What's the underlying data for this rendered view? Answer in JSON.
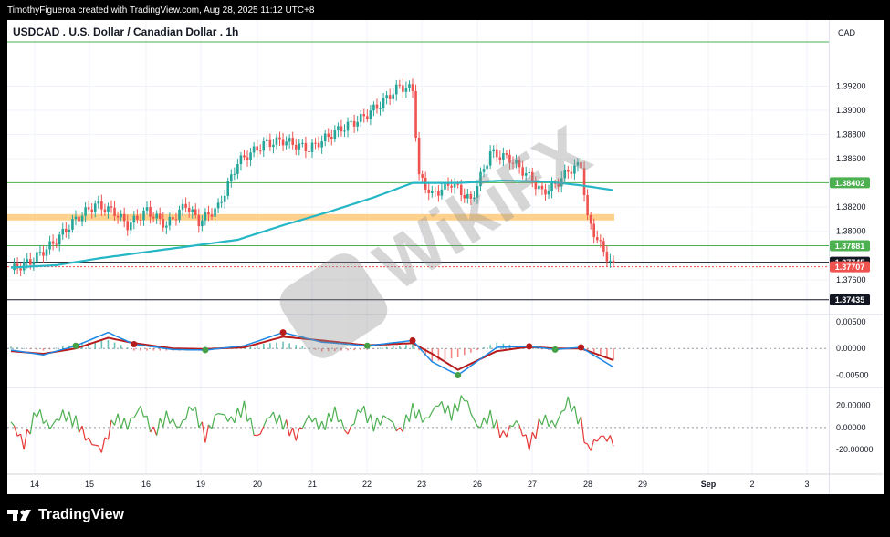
{
  "header": {
    "attribution": "TimothyFigueroa created with TradingView.com, Aug 28, 2025 11:12 UTC+8"
  },
  "chart_header": {
    "symbol_title": "USDCAD . U.S. Dollar / Canadian Dollar . 1h",
    "currency": "CAD"
  },
  "footer": {
    "brand": "TradingView"
  },
  "watermark": "WikiFX",
  "colors": {
    "up": "#26a69a",
    "down": "#ef5350",
    "ma": "#26b7c7",
    "zone": "#ffcc80",
    "green_line": "#4caf50",
    "macd": "#2e7d32",
    "signal": "#b71c1c",
    "rsi_up": "#4caf50",
    "rsi_dn": "#e53935"
  },
  "chart_data": [
    {
      "type": "candlestick",
      "title": "USDCAD . U.S. Dollar / Canadian Dollar . 1h",
      "x_ticks": [
        "14",
        "15",
        "16",
        "19",
        "20",
        "21",
        "22",
        "23",
        "26",
        "27",
        "28",
        "29",
        "Sep",
        "2",
        "3"
      ],
      "y_ticks": [
        "1.39200",
        "1.39000",
        "1.38800",
        "1.38600",
        "1.38200",
        "1.38000",
        "1.37600"
      ],
      "y_range": [
        1.3735,
        1.3955
      ],
      "price_path": [
        [
          0,
          1.3768
        ],
        [
          6,
          1.3775
        ],
        [
          13,
          1.379
        ],
        [
          20,
          1.381
        ],
        [
          26,
          1.3822
        ],
        [
          32,
          1.3816
        ],
        [
          36,
          1.3805
        ],
        [
          42,
          1.3817
        ],
        [
          48,
          1.3805
        ],
        [
          54,
          1.3822
        ],
        [
          58,
          1.3808
        ],
        [
          64,
          1.382
        ],
        [
          70,
          1.3857
        ],
        [
          78,
          1.3872
        ],
        [
          84,
          1.3875
        ],
        [
          92,
          1.3868
        ],
        [
          100,
          1.3882
        ],
        [
          108,
          1.3893
        ],
        [
          114,
          1.3905
        ],
        [
          120,
          1.392
        ],
        [
          124,
          1.3917
        ],
        [
          126,
          1.3845
        ],
        [
          130,
          1.383
        ],
        [
          136,
          1.384
        ],
        [
          142,
          1.3825
        ],
        [
          148,
          1.3865
        ],
        [
          154,
          1.386
        ],
        [
          160,
          1.3845
        ],
        [
          164,
          1.3832
        ],
        [
          168,
          1.3838
        ],
        [
          172,
          1.385
        ],
        [
          176,
          1.3855
        ],
        [
          178,
          1.381
        ],
        [
          182,
          1.3788
        ],
        [
          186,
          1.377
        ]
      ],
      "ma_path": [
        [
          0,
          1.377
        ],
        [
          14,
          1.3772
        ],
        [
          28,
          1.3778
        ],
        [
          42,
          1.3783
        ],
        [
          56,
          1.3788
        ],
        [
          70,
          1.3793
        ],
        [
          84,
          1.3805
        ],
        [
          98,
          1.3816
        ],
        [
          112,
          1.3828
        ],
        [
          124,
          1.384
        ],
        [
          138,
          1.384
        ],
        [
          152,
          1.3842
        ],
        [
          166,
          1.3841
        ],
        [
          176,
          1.3838
        ],
        [
          186,
          1.3834
        ]
      ],
      "horizontal_levels": [
        {
          "label": "1.38402",
          "value": 1.38402,
          "color": "#4caf50"
        },
        {
          "label": "1.37881",
          "value": 1.37881,
          "color": "#4caf50"
        },
        {
          "label": "1.37745",
          "value": 1.37745,
          "color": "#131722"
        },
        {
          "label": "1.37707",
          "value": 1.37707,
          "color": "#ef5350"
        },
        {
          "label": "1.37435",
          "value": 1.37435,
          "color": "#131722"
        }
      ],
      "zone": {
        "from": 1.381,
        "to": 1.3812
      }
    },
    {
      "type": "line",
      "indicator": "MACD",
      "y_ticks": [
        "0.00500",
        "0.00000",
        "-0.00500"
      ],
      "y_range": [
        -0.0068,
        0.0055
      ],
      "macd_path": [
        [
          0,
          -0.0003
        ],
        [
          10,
          -0.0012
        ],
        [
          20,
          0.0005
        ],
        [
          30,
          0.003
        ],
        [
          38,
          0.0008
        ],
        [
          50,
          -0.0002
        ],
        [
          60,
          -0.0003
        ],
        [
          72,
          0.0005
        ],
        [
          84,
          0.003
        ],
        [
          96,
          0.0012
        ],
        [
          110,
          0.0005
        ],
        [
          124,
          0.0015
        ],
        [
          130,
          -0.0025
        ],
        [
          138,
          -0.005
        ],
        [
          150,
          0.0002
        ],
        [
          160,
          0.0004
        ],
        [
          168,
          -0.0002
        ],
        [
          176,
          0.0002
        ],
        [
          186,
          -0.0035
        ]
      ],
      "signal_path": [
        [
          0,
          -0.0005
        ],
        [
          10,
          -0.001
        ],
        [
          20,
          0.0
        ],
        [
          30,
          0.002
        ],
        [
          38,
          0.001
        ],
        [
          50,
          0.0
        ],
        [
          60,
          -0.0001
        ],
        [
          72,
          0.0002
        ],
        [
          84,
          0.0022
        ],
        [
          96,
          0.0015
        ],
        [
          110,
          0.0006
        ],
        [
          124,
          0.001
        ],
        [
          130,
          -0.001
        ],
        [
          138,
          -0.004
        ],
        [
          150,
          -0.0005
        ],
        [
          160,
          0.0003
        ],
        [
          168,
          0.0
        ],
        [
          176,
          0.0
        ],
        [
          186,
          -0.0022
        ]
      ]
    },
    {
      "type": "line",
      "indicator": "Oscillator",
      "y_ticks": [
        "20.00000",
        "0.00000",
        "-20.00000"
      ],
      "y_range": [
        -38,
        32
      ],
      "osc_path": [
        [
          0,
          5
        ],
        [
          4,
          -15
        ],
        [
          8,
          15
        ],
        [
          12,
          0
        ],
        [
          16,
          12
        ],
        [
          20,
          5
        ],
        [
          24,
          -12
        ],
        [
          28,
          -20
        ],
        [
          32,
          8
        ],
        [
          36,
          2
        ],
        [
          40,
          18
        ],
        [
          44,
          -5
        ],
        [
          48,
          10
        ],
        [
          52,
          0
        ],
        [
          56,
          20
        ],
        [
          60,
          -8
        ],
        [
          64,
          14
        ],
        [
          68,
          6
        ],
        [
          72,
          18
        ],
        [
          76,
          -10
        ],
        [
          80,
          12
        ],
        [
          84,
          4
        ],
        [
          88,
          -8
        ],
        [
          92,
          10
        ],
        [
          96,
          0
        ],
        [
          100,
          14
        ],
        [
          104,
          -6
        ],
        [
          108,
          18
        ],
        [
          112,
          2
        ],
        [
          116,
          10
        ],
        [
          120,
          -4
        ],
        [
          124,
          16
        ],
        [
          128,
          6
        ],
        [
          132,
          22
        ],
        [
          136,
          12
        ],
        [
          140,
          28
        ],
        [
          144,
          0
        ],
        [
          148,
          10
        ],
        [
          152,
          -8
        ],
        [
          156,
          6
        ],
        [
          160,
          -16
        ],
        [
          164,
          8
        ],
        [
          168,
          2
        ],
        [
          172,
          24
        ],
        [
          176,
          4
        ],
        [
          178,
          -20
        ],
        [
          182,
          -8
        ],
        [
          186,
          -12
        ]
      ]
    }
  ]
}
